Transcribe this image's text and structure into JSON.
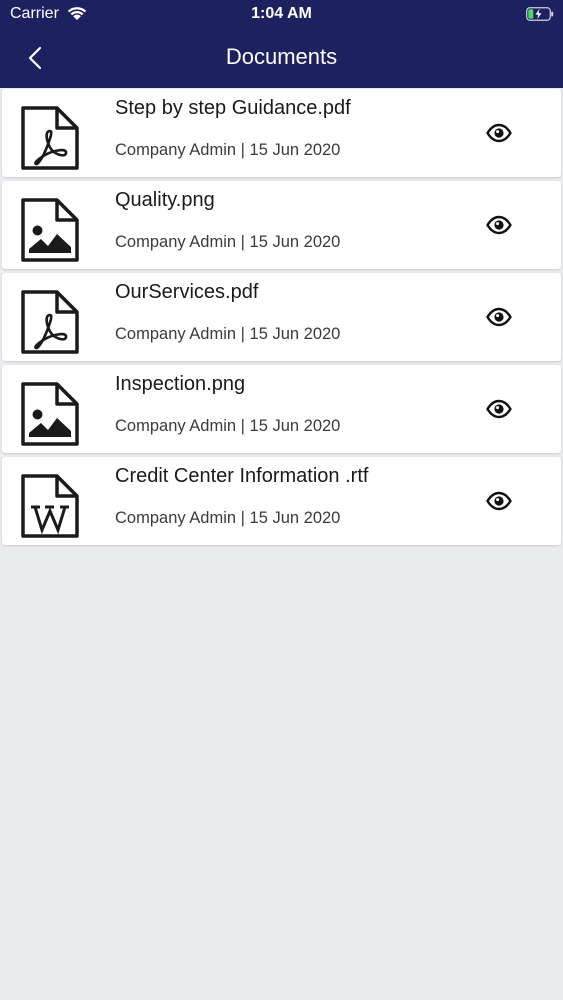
{
  "status_bar": {
    "carrier": "Carrier",
    "time": "1:04 AM",
    "wifi_icon": "wifi-icon",
    "battery_icon": "battery-charging-icon",
    "battery_color": "#4cd964"
  },
  "nav": {
    "title": "Documents",
    "back_icon": "chevron-left-icon",
    "background_color": "#1e2160"
  },
  "documents": [
    {
      "name": "Step by step Guidance.pdf",
      "meta": "Company Admin | 15 Jun 2020",
      "file_icon": "pdf-file-icon",
      "action_icon": "eye-icon"
    },
    {
      "name": "Quality.png",
      "meta": "Company Admin | 15 Jun 2020",
      "file_icon": "image-file-icon",
      "action_icon": "eye-icon"
    },
    {
      "name": "OurServices.pdf",
      "meta": "Company Admin | 15 Jun 2020",
      "file_icon": "pdf-file-icon",
      "action_icon": "eye-icon"
    },
    {
      "name": "Inspection.png",
      "meta": "Company Admin | 15 Jun 2020",
      "file_icon": "image-file-icon",
      "action_icon": "eye-icon"
    },
    {
      "name": "Credit Center Information .rtf",
      "meta": "Company Admin | 15 Jun 2020",
      "file_icon": "word-file-icon",
      "action_icon": "eye-icon"
    }
  ],
  "page_background": "#ebecef"
}
